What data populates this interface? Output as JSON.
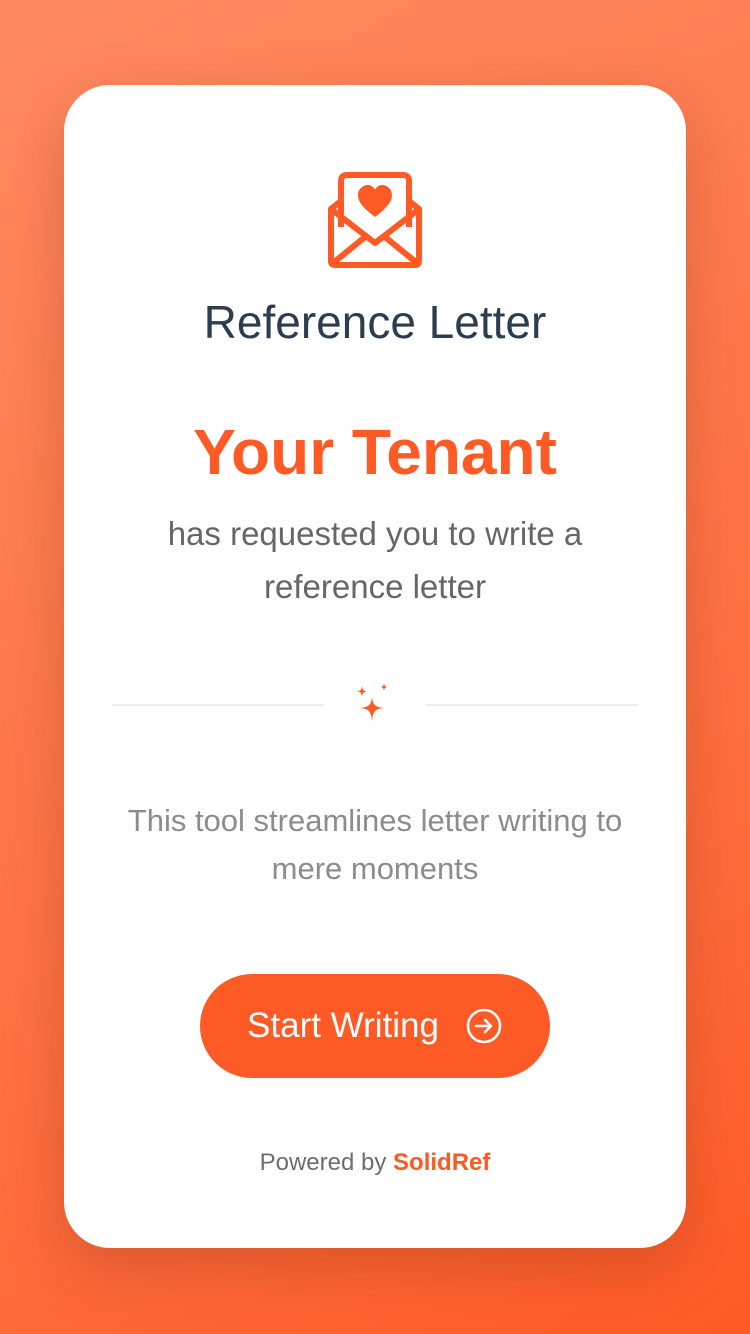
{
  "card": {
    "title": "Reference Letter",
    "requester": "Your Tenant",
    "request_text": "has requested you to write a reference letter",
    "description": "This tool streamlines letter writing to mere moments"
  },
  "actions": {
    "start_label": "Start Writing"
  },
  "footer": {
    "powered_by": "Powered by",
    "brand": "SolidRef"
  },
  "icons": {
    "header": "envelope-heart-icon",
    "divider": "sparkle-icon",
    "button": "arrow-right-circle-icon"
  },
  "colors": {
    "accent": "#fe5a25",
    "title": "#2d3d50",
    "body_text": "#666666",
    "muted_text": "#8c8c8c",
    "card_bg": "#ffffff"
  }
}
